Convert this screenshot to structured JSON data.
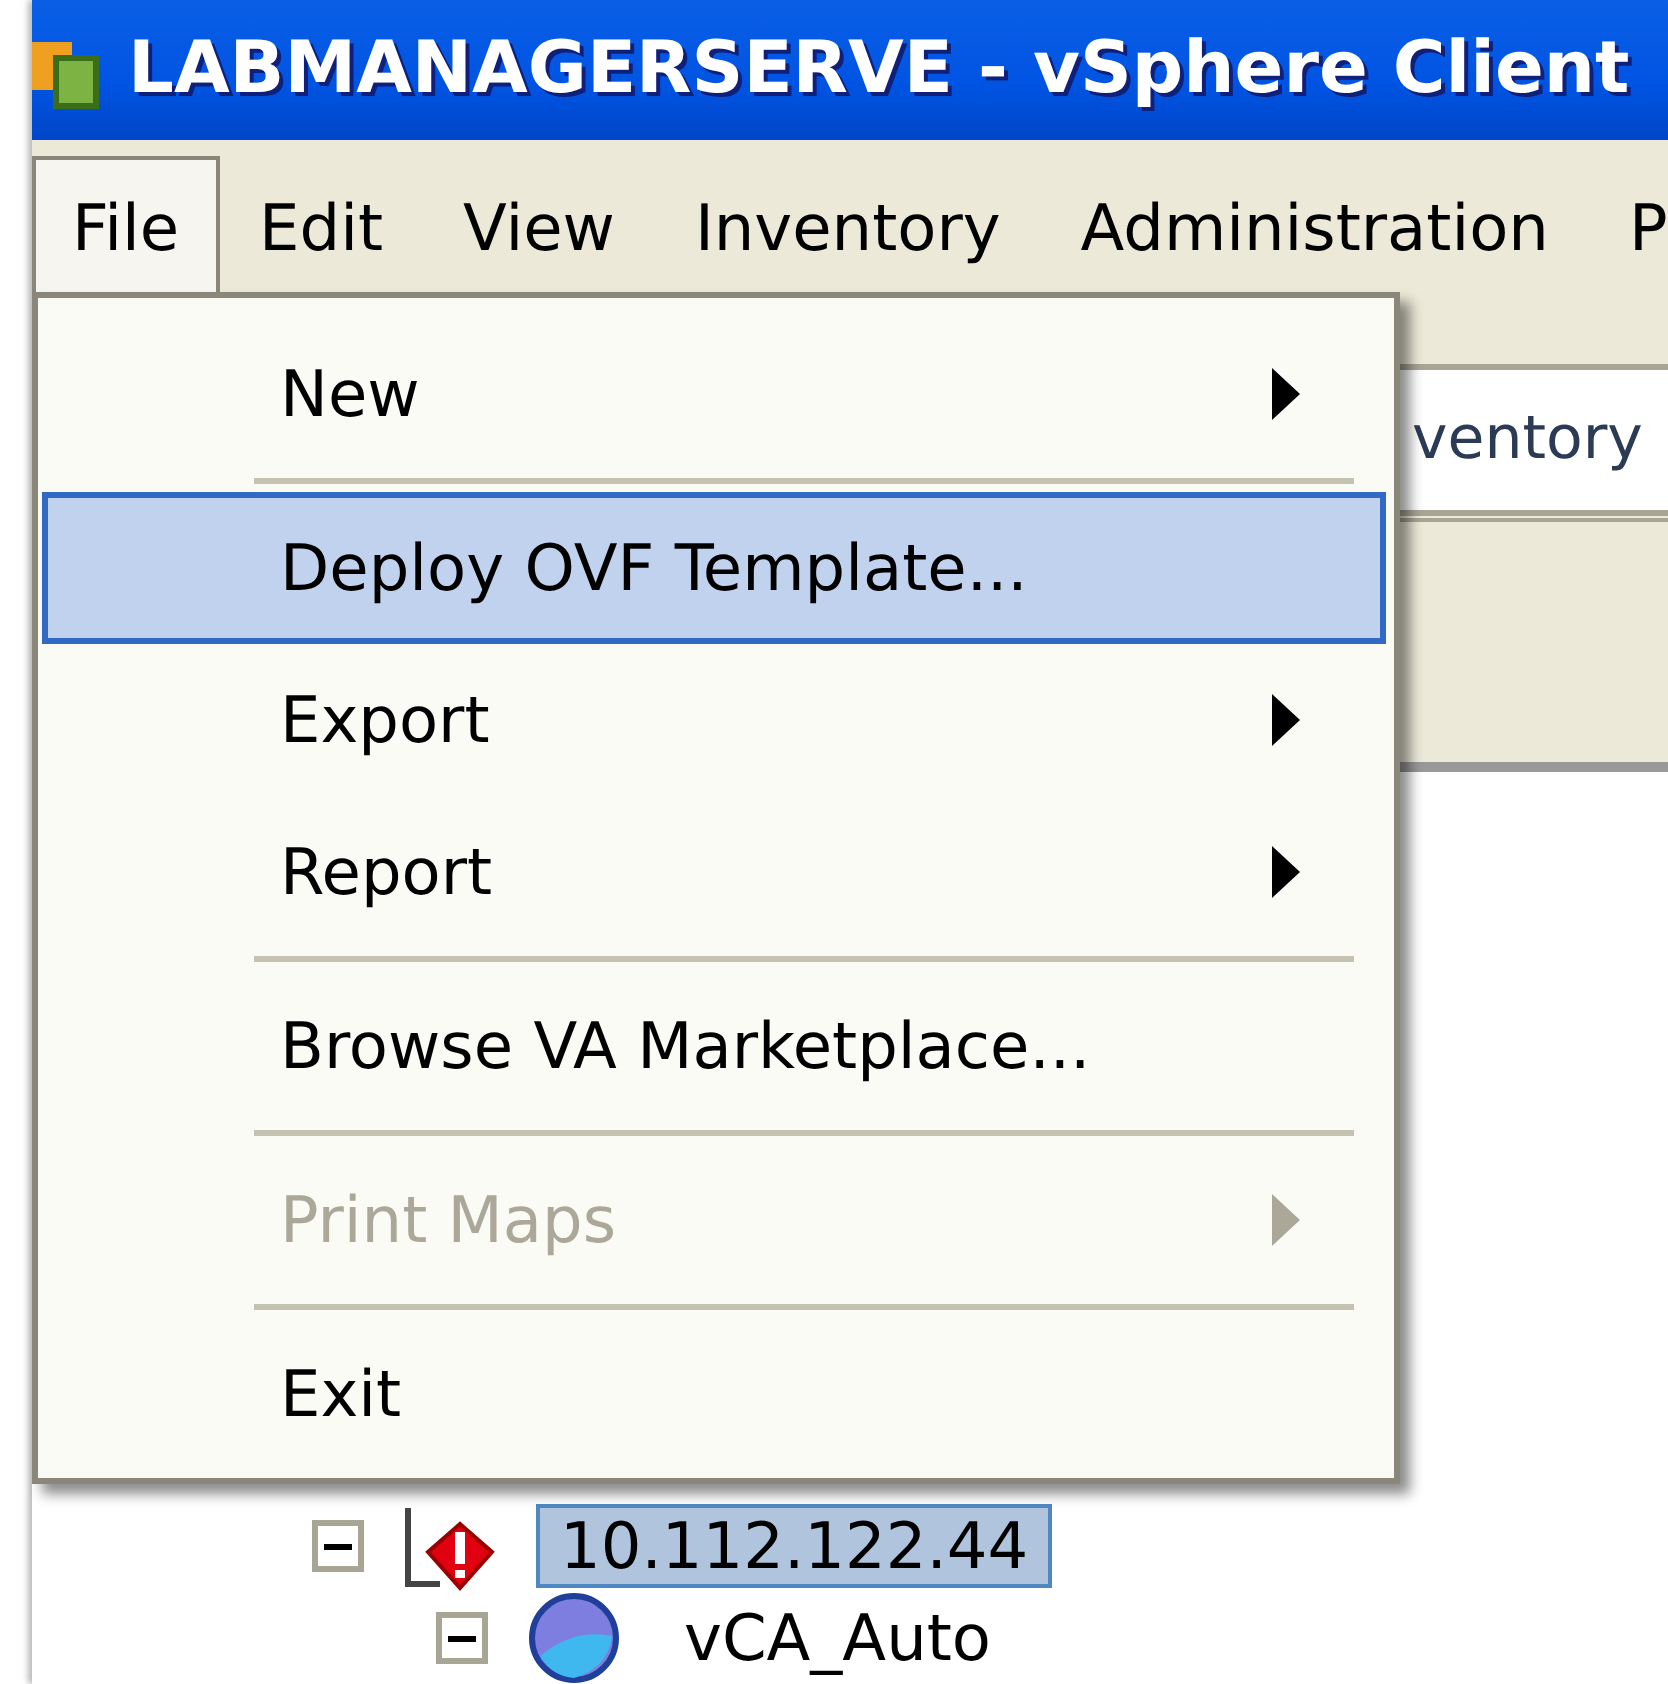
{
  "window": {
    "title": "LABMANAGERSERVE - vSphere Client"
  },
  "menubar": [
    {
      "label": "File",
      "selected": true
    },
    {
      "label": "Edit",
      "selected": false
    },
    {
      "label": "View",
      "selected": false
    },
    {
      "label": "Inventory",
      "selected": false
    },
    {
      "label": "Administration",
      "selected": false
    },
    {
      "label": "P",
      "selected": false
    }
  ],
  "breadcrumb": "ventory",
  "file_menu": [
    {
      "kind": "item",
      "label": "New",
      "submenu": true,
      "disabled": false,
      "selected": false
    },
    {
      "kind": "separator"
    },
    {
      "kind": "item",
      "label": "Deploy OVF Template...",
      "submenu": false,
      "disabled": false,
      "selected": true
    },
    {
      "kind": "item",
      "label": "Export",
      "submenu": true,
      "disabled": false,
      "selected": false
    },
    {
      "kind": "item",
      "label": "Report",
      "submenu": true,
      "disabled": false,
      "selected": false
    },
    {
      "kind": "separator"
    },
    {
      "kind": "item",
      "label": "Browse VA Marketplace...",
      "submenu": false,
      "disabled": false,
      "selected": false
    },
    {
      "kind": "separator"
    },
    {
      "kind": "item",
      "label": "Print Maps",
      "submenu": true,
      "disabled": true,
      "selected": false
    },
    {
      "kind": "separator"
    },
    {
      "kind": "item",
      "label": "Exit",
      "submenu": false,
      "disabled": false,
      "selected": false
    }
  ],
  "tree": [
    {
      "label": "10.112.122.44",
      "kind": "host_alert",
      "expanded": true,
      "selected": true,
      "children": [
        {
          "label": "vCA_Auto",
          "kind": "vm",
          "expanded": true,
          "selected": false
        }
      ]
    }
  ]
}
